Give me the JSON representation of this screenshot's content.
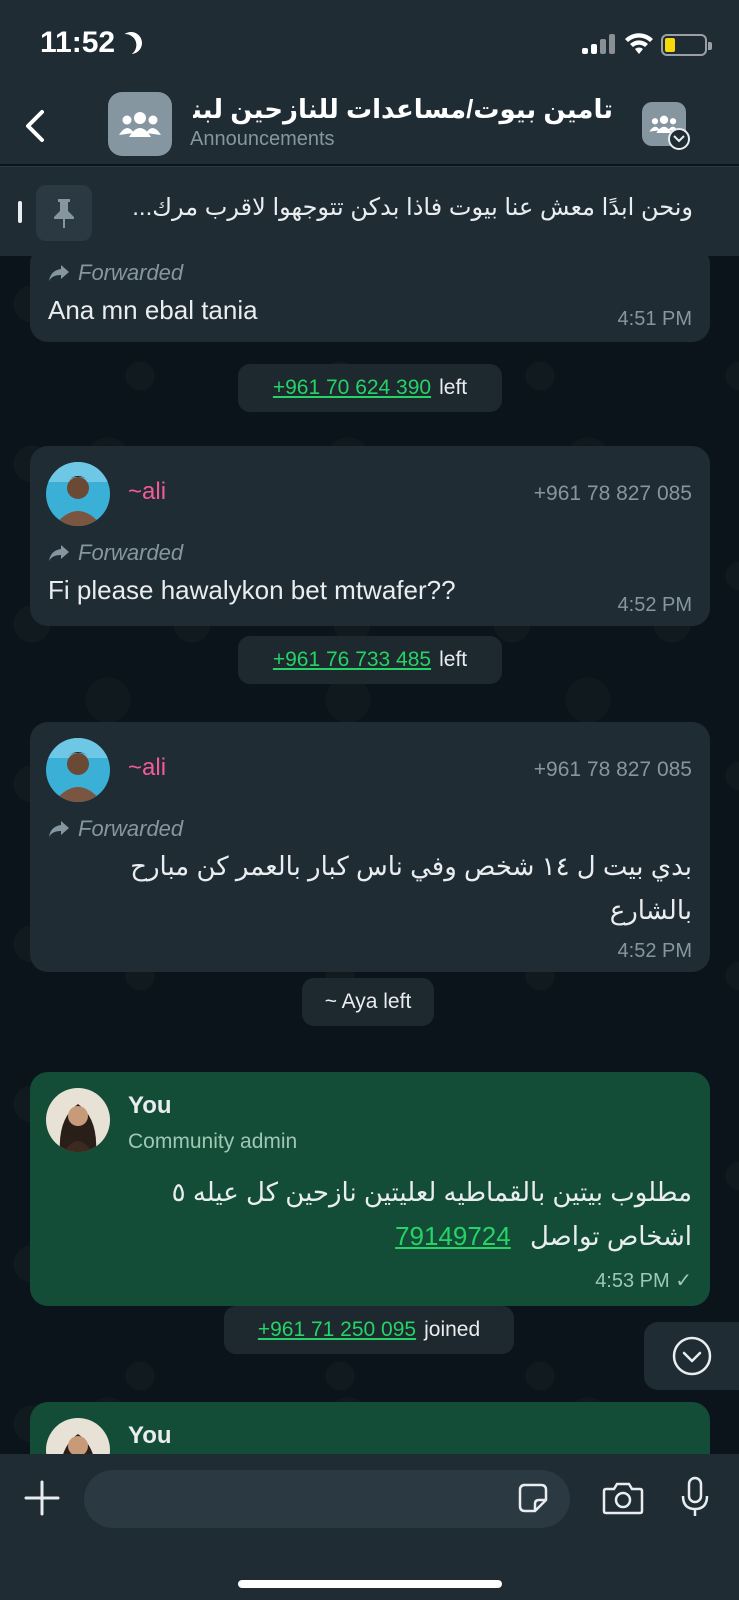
{
  "status_bar": {
    "time": "11:52"
  },
  "header": {
    "back_label": "",
    "title": "تامين بيوت/مساعدات للنازحين لبنان",
    "subtitle": "Announcements"
  },
  "pinned": {
    "text": "ونحن ابدًا معش عنا بيوت فاذا بدكن تتوجهوا لاقرب مرك..."
  },
  "messages": [
    {
      "forwarded": "Forwarded",
      "text": "Ana mn ebal tania",
      "time": "4:51 PM"
    },
    {
      "sender": "~ali",
      "phone": "+961 78 827 085",
      "forwarded": "Forwarded",
      "text": "Fi please hawalykon bet mtwafer??",
      "time": "4:52 PM"
    },
    {
      "sender": "~ali",
      "phone": "+961 78 827 085",
      "forwarded": "Forwarded",
      "text_line1": "بدي بيت ل ١٤ شخص وفي ناس كبار بالعمر كن مبارح",
      "text_line2": "بالشارع",
      "time": "4:52 PM"
    },
    {
      "sender": "You",
      "role": "Community admin",
      "text_line1": "مطلوب بيتين بالقماطيه لعليتين نازحين كل عيله ٥",
      "text_line2_prefix": "اشخاص تواصل",
      "text_line2_link": "79149724",
      "time": "4:53 PM",
      "status": "✓"
    },
    {
      "sender": "You"
    }
  ],
  "system": [
    {
      "phone": "+961 70 624 390",
      "action": "left"
    },
    {
      "phone": "+961 76 733 485",
      "action": "left"
    },
    {
      "text": "~ Aya left"
    },
    {
      "phone": "+961 71 250 095",
      "action": "joined"
    }
  ],
  "input": {
    "placeholder": ""
  },
  "colors": {
    "accent_green": "#25d366",
    "sender_pink": "#f15c98",
    "outgoing_bubble": "#134d37"
  }
}
